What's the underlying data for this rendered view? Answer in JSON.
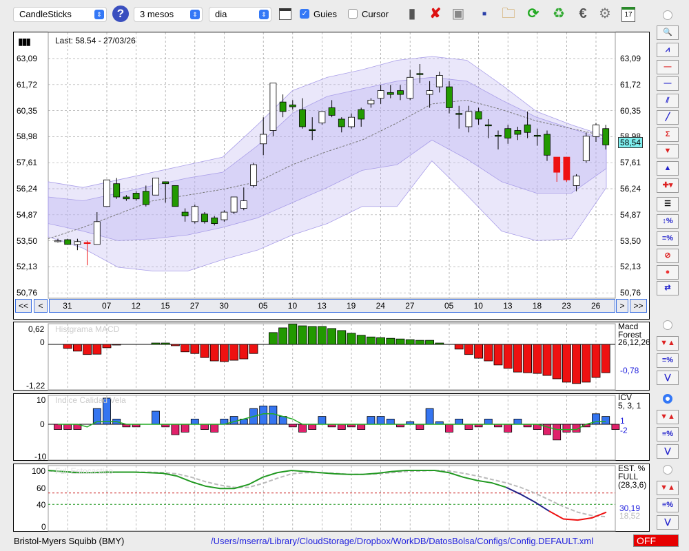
{
  "toolbar": {
    "chart_type": "CandleSticks",
    "period": "3 mesos",
    "interval": "dia",
    "guides_label": "Guies",
    "guides_checked": true,
    "cursor_label": "Cursor",
    "cursor_checked": false,
    "icons": [
      "trash-icon",
      "delete-icon",
      "lamp-icon",
      "save-icon",
      "open-folder-icon",
      "refresh-icon",
      "recycle-icon",
      "euro-icon",
      "settings-icon",
      "calendar-icon"
    ],
    "calendar_day": "17"
  },
  "main": {
    "last": "Last: 58.54 - 27/03/26",
    "price_labels": [
      "63,09",
      "61,72",
      "60,35",
      "58,98",
      "57,61",
      "56,24",
      "54,87",
      "53,50",
      "52,13",
      "50,76"
    ],
    "current_price": "58,54",
    "nav": {
      "first": "<<",
      "prev": "<",
      "next": ">",
      "last": ">>"
    },
    "date_labels": [
      {
        "t": "31",
        "i": 1
      },
      {
        "t": "07",
        "i": 5
      },
      {
        "t": "12",
        "i": 8
      },
      {
        "t": "15",
        "i": 11
      },
      {
        "t": "27",
        "i": 14
      },
      {
        "t": "30",
        "i": 17
      },
      {
        "t": "05",
        "i": 21
      },
      {
        "t": "10",
        "i": 24
      },
      {
        "t": "13",
        "i": 27
      },
      {
        "t": "19",
        "i": 30
      },
      {
        "t": "24",
        "i": 33
      },
      {
        "t": "27",
        "i": 36
      },
      {
        "t": "05",
        "i": 40
      },
      {
        "t": "10",
        "i": 43
      },
      {
        "t": "13",
        "i": 46
      },
      {
        "t": "18",
        "i": 49
      },
      {
        "t": "23",
        "i": 52
      },
      {
        "t": "26",
        "i": 55
      }
    ],
    "candles": [
      [
        53.5,
        53.5,
        53.6,
        53.4
      ],
      [
        53.55,
        53.3,
        53.6,
        53.3
      ],
      [
        53.3,
        53.45,
        53.6,
        53.0
      ],
      [
        53.4,
        53.4,
        53.5,
        52.2
      ],
      [
        53.3,
        54.5,
        55.0,
        53.3
      ],
      [
        55.3,
        56.7,
        56.7,
        55.3
      ],
      [
        56.5,
        55.8,
        56.8,
        55.7
      ],
      [
        55.8,
        55.7,
        55.9,
        55.6
      ],
      [
        56.0,
        55.7,
        56.1,
        55.6
      ],
      [
        56.1,
        55.4,
        56.4,
        55.3
      ],
      [
        55.9,
        56.8,
        56.8,
        55.9
      ],
      [
        56.6,
        56.5,
        56.6,
        55.5
      ],
      [
        56.4,
        55.3,
        56.4,
        55.3
      ],
      [
        55.0,
        54.8,
        55.2,
        54.5
      ],
      [
        54.5,
        55.3,
        55.4,
        54.4
      ],
      [
        54.9,
        54.5,
        55.0,
        54.4
      ],
      [
        54.7,
        54.4,
        54.8,
        54.3
      ],
      [
        54.6,
        55.0,
        55.1,
        54.5
      ],
      [
        55.0,
        55.8,
        55.8,
        54.9
      ],
      [
        55.2,
        55.6,
        56.3,
        55.1
      ],
      [
        56.4,
        57.5,
        57.6,
        56.3
      ],
      [
        58.6,
        59.1,
        60.0,
        58.0
      ],
      [
        59.3,
        61.8,
        61.8,
        59.0
      ],
      [
        60.8,
        60.3,
        61.2,
        60.0
      ],
      [
        60.65,
        60.55,
        60.9,
        60.4
      ],
      [
        60.4,
        59.5,
        61.0,
        59.4
      ],
      [
        59.35,
        59.3,
        60.0,
        58.8
      ],
      [
        59.7,
        60.3,
        60.3,
        59.6
      ],
      [
        60.5,
        60.1,
        60.9,
        60.0
      ],
      [
        59.9,
        59.5,
        60.0,
        59.2
      ],
      [
        59.5,
        60.0,
        60.2,
        59.4
      ],
      [
        60.4,
        59.9,
        60.5,
        59.5
      ],
      [
        60.7,
        60.9,
        61.0,
        60.5
      ],
      [
        61.0,
        61.4,
        61.7,
        60.7
      ],
      [
        61.3,
        61.2,
        61.7,
        61.0
      ],
      [
        61.4,
        61.2,
        61.7,
        60.9
      ],
      [
        61.0,
        62.1,
        62.5,
        60.9
      ],
      [
        62.3,
        62.25,
        62.8,
        61.8
      ],
      [
        61.2,
        61.4,
        61.9,
        60.5
      ],
      [
        61.6,
        62.2,
        62.4,
        61.3
      ],
      [
        61.6,
        60.5,
        61.9,
        60.2
      ],
      [
        60.2,
        60.15,
        60.6,
        59.4
      ],
      [
        59.5,
        60.3,
        60.6,
        59.2
      ],
      [
        60.3,
        59.9,
        60.5,
        59.6
      ],
      [
        59.6,
        59.55,
        59.9,
        58.9
      ],
      [
        59.05,
        59.0,
        59.3,
        58.3
      ],
      [
        59.4,
        58.9,
        59.6,
        58.6
      ],
      [
        59.3,
        59.1,
        59.5,
        58.8
      ],
      [
        59.6,
        59.2,
        60.3,
        58.9
      ],
      [
        59.05,
        59.0,
        59.4,
        58.5
      ],
      [
        59.1,
        58.0,
        59.3,
        57.7
      ],
      [
        57.9,
        57.1,
        57.9,
        56.6
      ],
      [
        57.9,
        56.7,
        57.9,
        56.6
      ],
      [
        56.4,
        56.9,
        57.0,
        56.1
      ],
      [
        57.7,
        59.0,
        59.2,
        57.6
      ],
      [
        58.98,
        59.6,
        59.7,
        58.7
      ],
      [
        59.4,
        58.54,
        59.6,
        58.3
      ]
    ],
    "band_upper_outer": [
      56.6,
      56.3,
      56.7,
      57.1,
      57.5,
      57.9,
      59.6,
      61.4,
      62.1,
      62.5,
      63.0,
      63.2,
      63.0,
      61.7,
      60.3,
      59.6,
      59.0
    ],
    "band_lower_outer": [
      53.7,
      53.1,
      52.1,
      51.9,
      51.9,
      52.5,
      53.0,
      53.8,
      54.4,
      55.3,
      55.3,
      57.7,
      55.9,
      54.0,
      53.5,
      53.6,
      56.3
    ],
    "band_upper_inner": [
      55.8,
      55.6,
      56.0,
      56.4,
      56.8,
      57.1,
      58.5,
      60.2,
      61.1,
      61.5,
      61.9,
      62.1,
      61.9,
      60.9,
      60.0,
      59.4,
      58.8
    ],
    "band_lower_inner": [
      54.4,
      54.0,
      53.5,
      53.6,
      53.8,
      54.2,
      54.7,
      55.5,
      56.3,
      57.2,
      57.5,
      58.8,
      57.8,
      56.6,
      56.0,
      56.0,
      57.3
    ],
    "middle": [
      53.6,
      54.2,
      54.9,
      55.6,
      55.9,
      56.2,
      56.6,
      57.5,
      58.2,
      58.8,
      59.7,
      60.7,
      60.9,
      60.4,
      59.8,
      59.4,
      59.0
    ]
  },
  "macd": {
    "title": "Histgrama MACD",
    "max": "0,62",
    "zero": "0",
    "min": "-1,22",
    "name1": "Macd",
    "name2": "Forest",
    "params": "26,12,26",
    "value": "-0,78",
    "values": [
      0,
      -0.12,
      -0.2,
      -0.3,
      -0.29,
      -0.1,
      -0.02,
      0,
      0,
      0,
      0.04,
      0.04,
      -0.04,
      -0.22,
      -0.27,
      -0.39,
      -0.49,
      -0.51,
      -0.47,
      -0.43,
      -0.27,
      0,
      0.35,
      0.49,
      0.6,
      0.55,
      0.53,
      0.53,
      0.47,
      0.41,
      0.33,
      0.27,
      0.22,
      0.2,
      0.18,
      0.16,
      0.14,
      0.12,
      0.12,
      0.04,
      0,
      -0.14,
      -0.3,
      -0.41,
      -0.49,
      -0.61,
      -0.71,
      -0.82,
      -0.84,
      -0.86,
      -0.92,
      -1.02,
      -1.12,
      -1.16,
      -1.12,
      -0.98,
      -0.84
    ]
  },
  "icv": {
    "title": "Indice Calidad Vela",
    "max": "10",
    "zero": "0",
    "min": "-10",
    "name": "ICV",
    "params": "5, 3, 1",
    "value1": "1",
    "value2": "-2",
    "values": [
      -2,
      -2,
      -2,
      0,
      6,
      10,
      2,
      -1,
      -1,
      0,
      5,
      -1,
      -4,
      -3,
      2,
      -2,
      -3,
      2,
      3,
      2,
      6,
      7,
      7,
      3,
      -1,
      -3,
      -2,
      3,
      -1,
      -2,
      -1,
      -2,
      3,
      3,
      2,
      -1,
      1,
      -2,
      6,
      1,
      -3,
      2,
      -2,
      -1,
      2,
      -1,
      -3,
      2,
      -1,
      -2,
      -4,
      -6,
      -3,
      -3,
      -1,
      4,
      3,
      -2
    ],
    "line": [
      0,
      0,
      0,
      -1,
      1,
      1,
      1,
      0,
      0,
      0,
      0,
      0,
      0,
      0,
      0,
      0,
      0,
      0,
      1,
      2,
      3,
      4,
      4,
      3,
      2,
      0,
      0,
      0,
      0,
      0,
      0,
      0,
      0,
      0,
      0,
      0,
      0,
      0,
      0,
      0,
      0,
      0,
      0,
      0,
      0,
      0,
      0,
      0,
      0,
      0,
      -1,
      -2,
      -2,
      -2,
      0,
      1,
      1
    ]
  },
  "stoch": {
    "title": "Full Estocastico",
    "ticks": [
      "100",
      "60",
      "40",
      "0"
    ],
    "name": "EST. %",
    "type": "FULL",
    "params": "(28,3,6)",
    "value_k": "30,19",
    "value_d": "18,52",
    "k": [
      100,
      98,
      96,
      96,
      97,
      97,
      97,
      96,
      95,
      90,
      80,
      72,
      68,
      68,
      75,
      88,
      96,
      100,
      98,
      96,
      94,
      93,
      93,
      95,
      98,
      100,
      100,
      100,
      96,
      88,
      82,
      78,
      70,
      58,
      44,
      28,
      14,
      12,
      16,
      26
    ],
    "d": [
      99,
      98,
      97,
      96,
      96,
      97,
      97,
      97,
      96,
      94,
      88,
      80,
      74,
      70,
      70,
      77,
      86,
      94,
      96,
      96,
      95,
      93,
      93,
      94,
      96,
      98,
      99,
      100,
      99,
      95,
      90,
      84,
      78,
      70,
      60,
      48,
      36,
      26,
      20,
      18
    ]
  },
  "status": {
    "company": "Bristol-Myers Squibb (BMY)",
    "path": "/Users/mserra/Library/CloudStorage/Dropbox/WorkDB/DatosBolsa/Configs/Config.DEFAULT.xml",
    "toggle": "OFF"
  },
  "colors": {
    "up": "#229900",
    "down": "#ee1111",
    "icv_pos": "#3575f0",
    "icv_neg": "#e0206a",
    "band": "#b8aef0"
  }
}
